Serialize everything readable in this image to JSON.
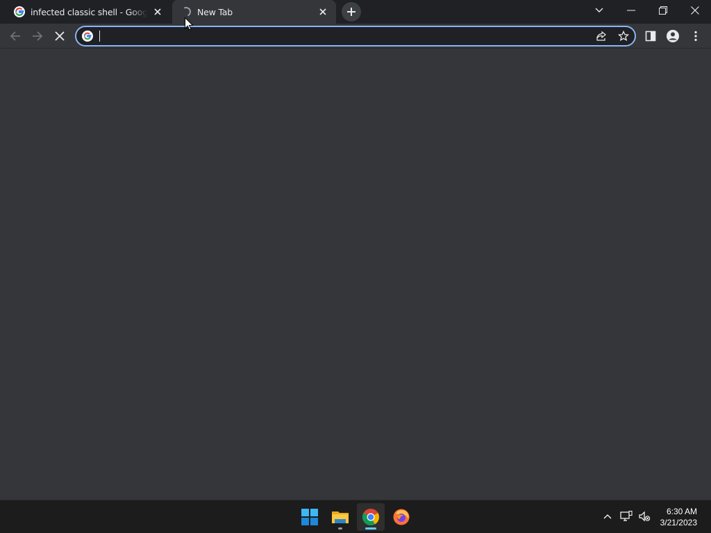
{
  "browser": {
    "tabs": [
      {
        "title": "infected classic shell - Google Se",
        "favicon": "google-g-icon",
        "state": "inactive"
      },
      {
        "title": "New Tab",
        "favicon": "loading-spinner-icon",
        "state": "active"
      }
    ],
    "omnibox": {
      "value": "",
      "placeholder": ""
    },
    "colors": {
      "frame": "#202124",
      "toolbar": "#35363a",
      "focus_ring": "#8ab4f8",
      "text": "#e8eaed",
      "icon": "#9aa0a6"
    }
  },
  "taskbar": {
    "apps": [
      "windows-start-icon",
      "file-explorer-icon",
      "chrome-icon",
      "firefox-icon"
    ],
    "clock": {
      "time": "6:30 AM",
      "date": "3/21/2023"
    }
  }
}
